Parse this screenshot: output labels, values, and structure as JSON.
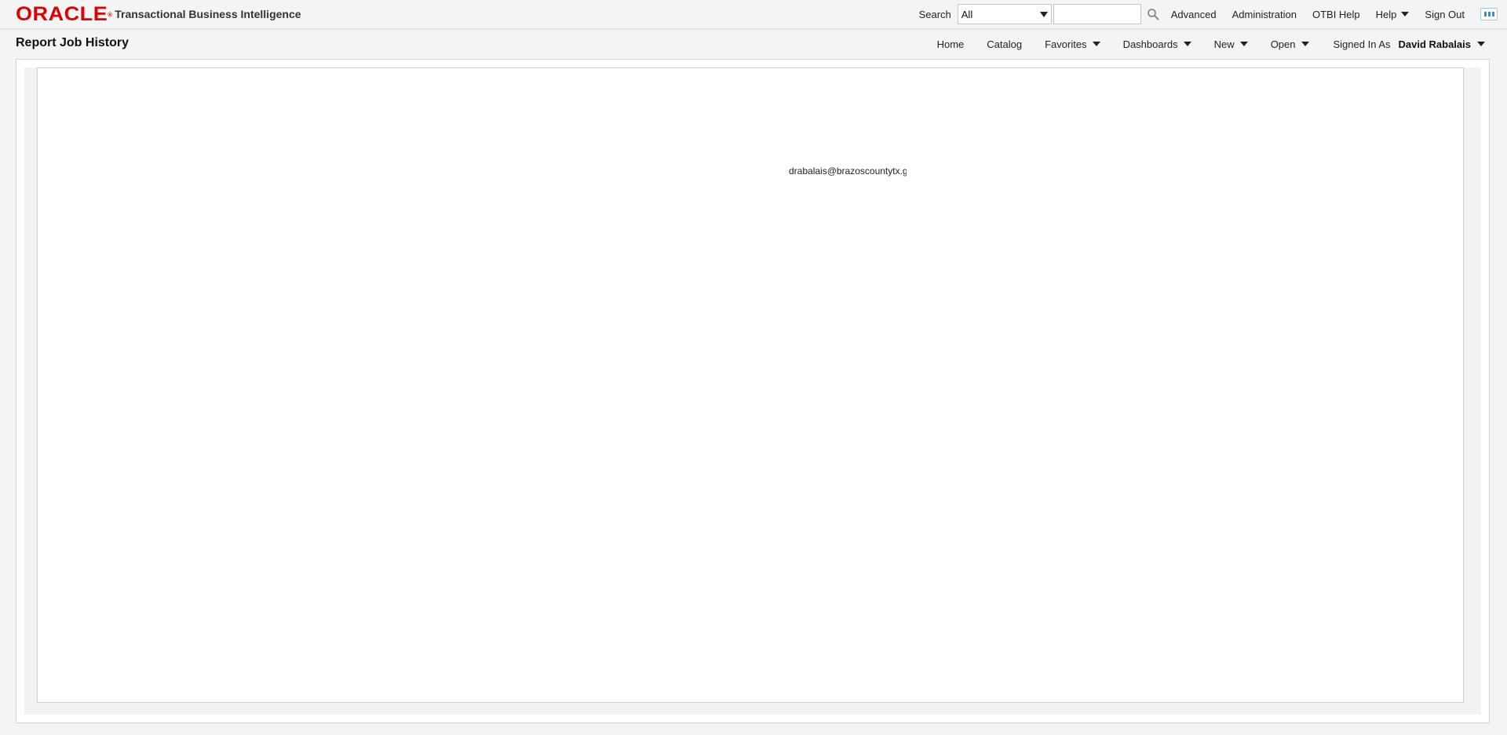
{
  "header": {
    "logo_text": "ORACLE",
    "product_name": "Transactional Business Intelligence",
    "search_label": "Search",
    "search_scope": "All",
    "search_value": "",
    "links": {
      "advanced": "Advanced",
      "administration": "Administration",
      "otbi_help": "OTBI Help",
      "help": "Help",
      "sign_out": "Sign Out"
    },
    "icons": {
      "search": "magnifier-icon",
      "apps": "apps-grid-icon"
    }
  },
  "page": {
    "title": "Report Job History"
  },
  "global_nav": {
    "home": "Home",
    "catalog": "Catalog",
    "favorites": "Favorites",
    "dashboards": "Dashboards",
    "new": "New",
    "open": "Open",
    "signed_in_as": "Signed In As",
    "user_name": "David Rabalais"
  },
  "report": {
    "email": "drabalais@brazoscountytx.g"
  },
  "colors": {
    "brand_red": "#e00000",
    "background": "#f4f4f4",
    "accent_blue": "#3d8ad2"
  }
}
